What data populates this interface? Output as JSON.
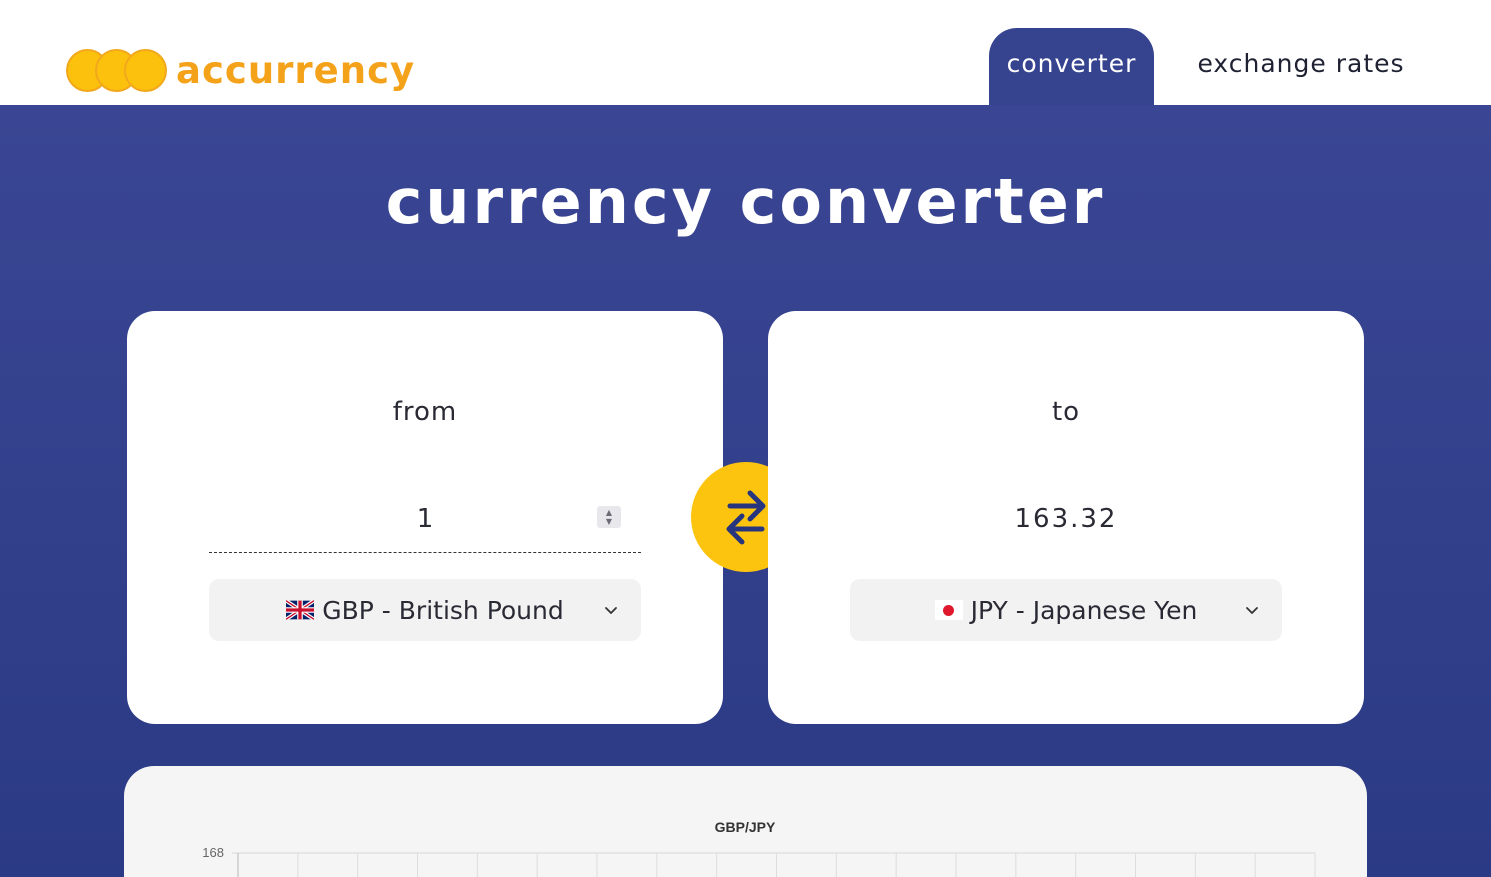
{
  "header": {
    "logo_text": "accurrency",
    "tabs": [
      {
        "label": "converter",
        "active": true
      },
      {
        "label": "exchange rates",
        "active": false
      }
    ]
  },
  "main": {
    "title": "currency converter",
    "from": {
      "label": "from",
      "amount": "1",
      "currency": "GBP - British Pound",
      "flag_icon": "uk-flag-icon"
    },
    "to": {
      "label": "to",
      "amount": "163.32",
      "currency": "JPY - Japanese Yen",
      "flag_icon": "japan-flag-icon"
    },
    "swap_icon": "swap-arrows-icon"
  },
  "colors": {
    "brand_orange": "#f4a21a",
    "coin_yellow": "#fcc10c",
    "navy": "#36448f",
    "swap_yellow": "#fcc40e",
    "arrow_navy": "#26357d"
  },
  "chart_data": {
    "type": "line",
    "title": "GBP/JPY",
    "y_ticks": [
      168
    ],
    "grid": true
  }
}
